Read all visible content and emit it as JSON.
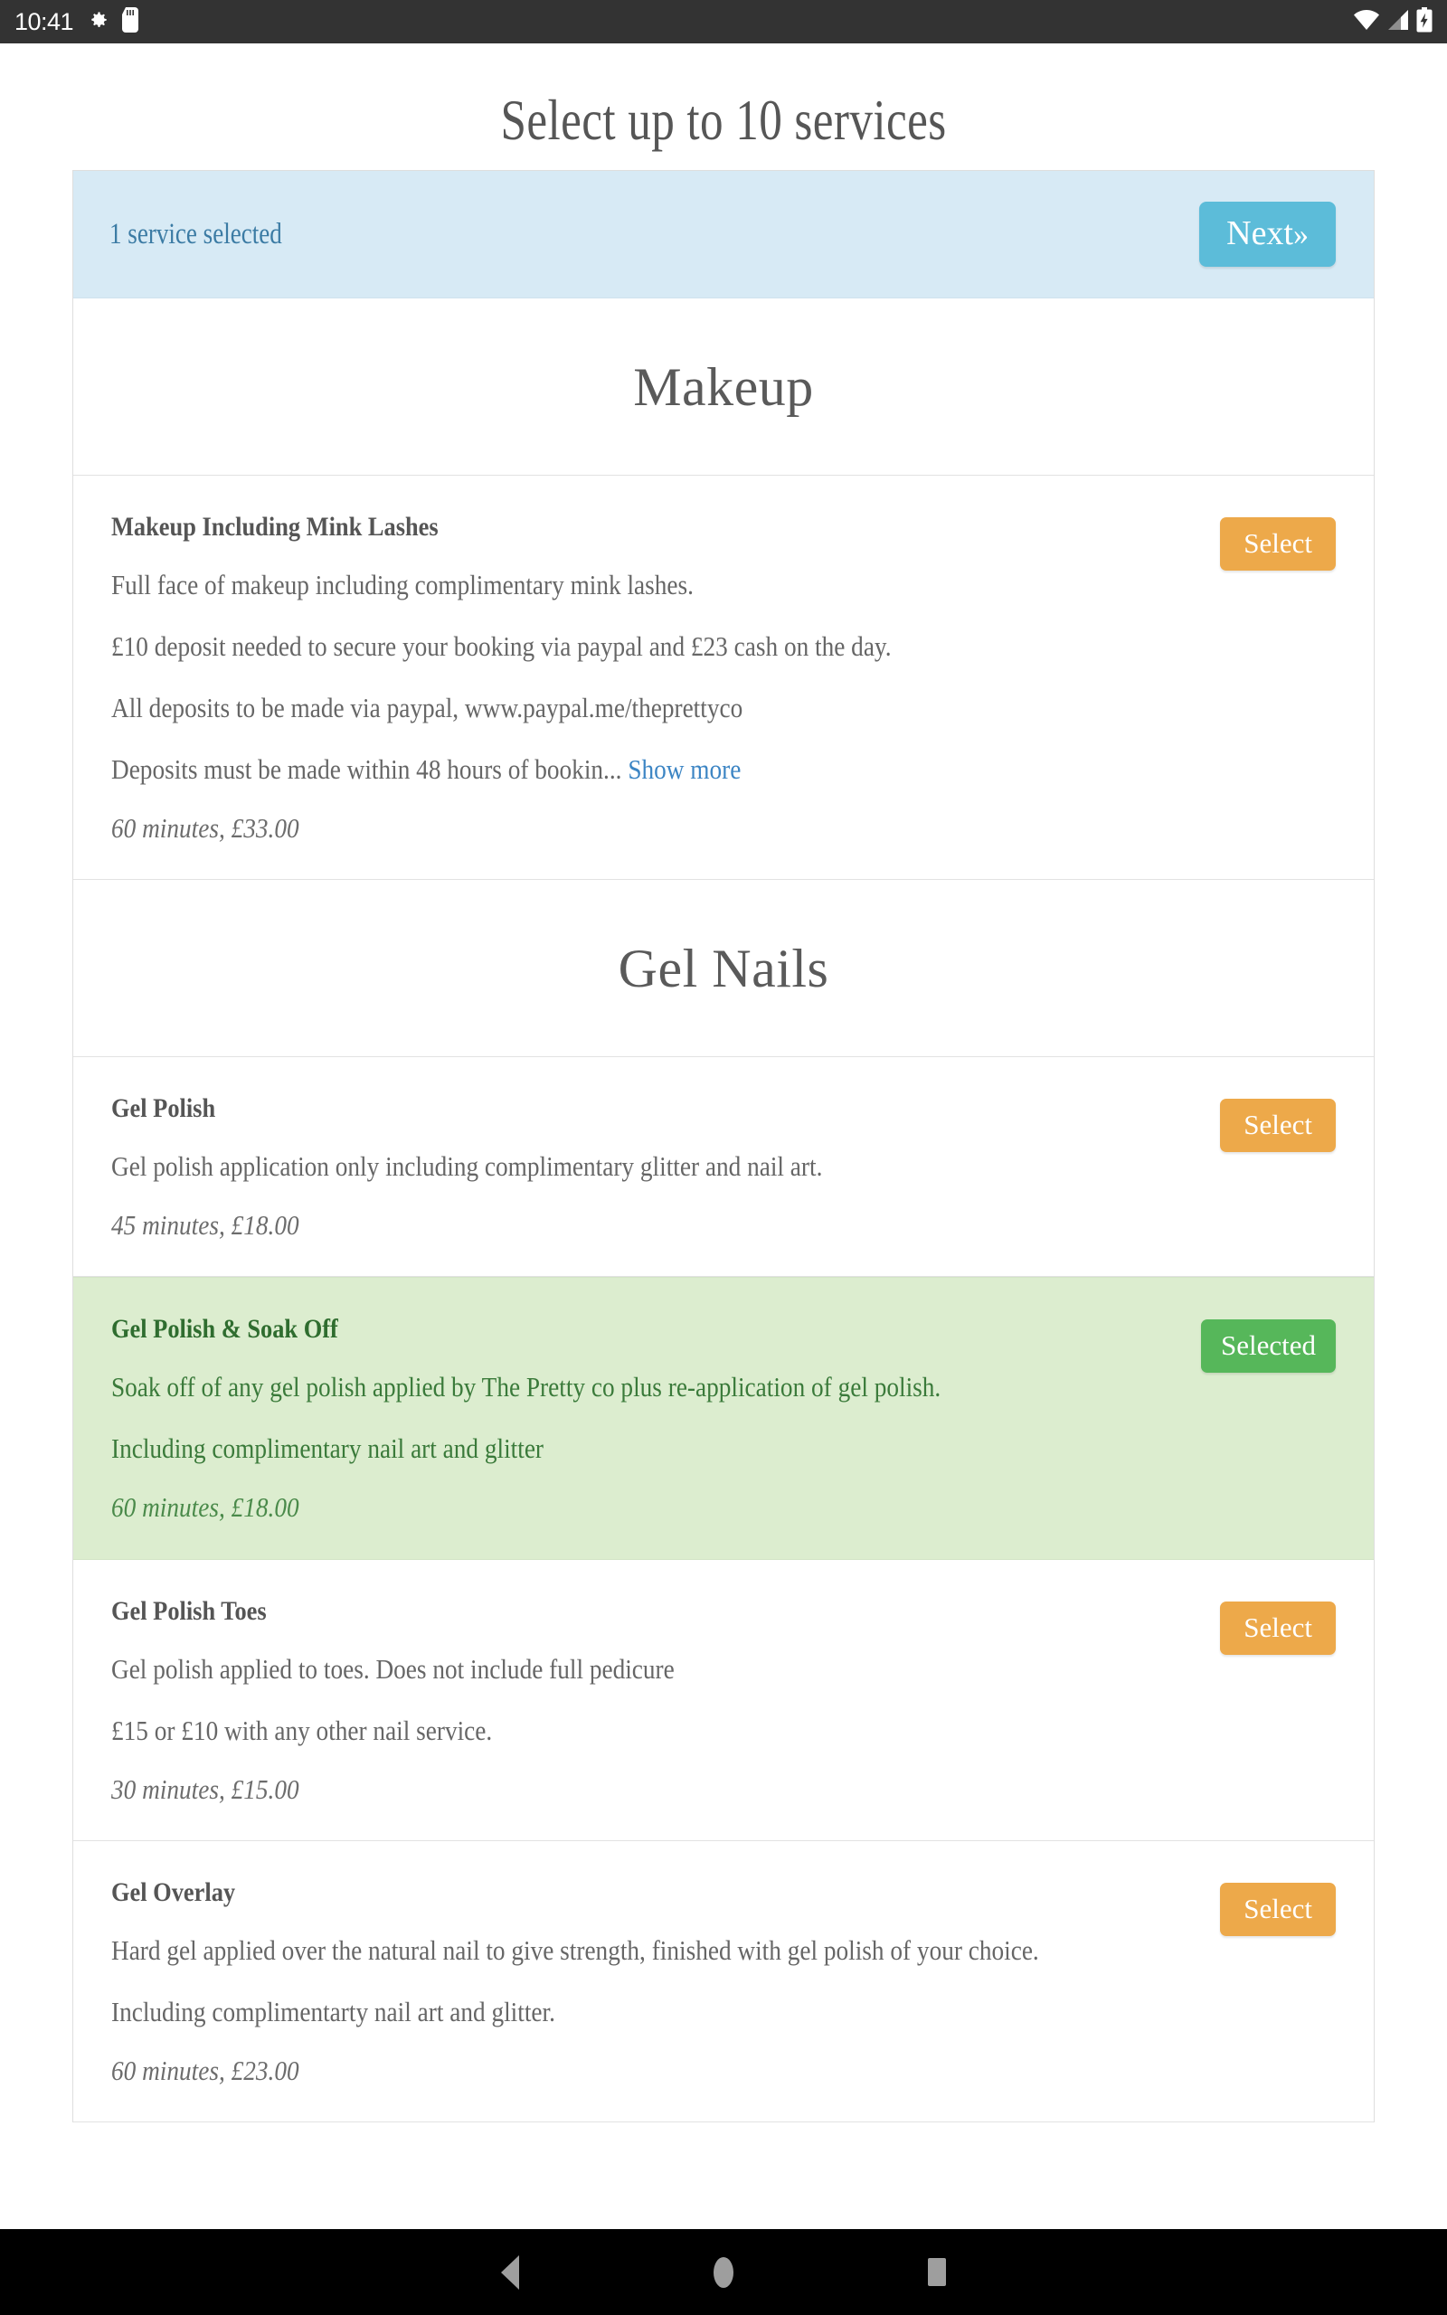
{
  "status_bar": {
    "clock": "10:41",
    "left_icons": [
      "gear-icon",
      "sd-card-icon"
    ],
    "right_icons": [
      "wifi-icon",
      "signal-icon",
      "battery-charging-icon"
    ],
    "background": "#333333"
  },
  "page": {
    "title": "Select up to 10 services"
  },
  "banner": {
    "status_text": "1 service selected",
    "next_label": "Next",
    "next_chevron": "»",
    "background": "#d7eaf5",
    "text_color": "#3b7ba4",
    "button_color": "#5cbcd9"
  },
  "colors": {
    "select_button": "#eda94a",
    "selected_button": "#56b75a",
    "selected_row_bg": "#dcedcf",
    "link": "#3c85c4"
  },
  "sections": [
    {
      "heading": "Makeup",
      "services": [
        {
          "name": "Makeup Including Mink Lashes",
          "paragraphs": [
            "Full face of makeup including complimentary mink lashes.",
            "£10 deposit needed to secure your booking via paypal and £23 cash on the day.",
            "All deposits to be made via paypal, www.paypal.me/theprettyco"
          ],
          "truncated_paragraph": "Deposits must be made within 48 hours of bookin...",
          "show_more_label": "Show more",
          "meta": "60 minutes, £33.00",
          "action_label": "Select",
          "selected": false
        }
      ]
    },
    {
      "heading": "Gel Nails",
      "services": [
        {
          "name": "Gel Polish",
          "paragraphs": [
            "Gel polish application only including complimentary glitter and nail art."
          ],
          "meta": "45 minutes, £18.00",
          "action_label": "Select",
          "selected": false
        },
        {
          "name": "Gel Polish & Soak Off",
          "paragraphs": [
            "Soak off of any gel polish applied by The Pretty co plus re-application of gel polish.",
            "Including complimentary nail art and glitter"
          ],
          "meta": "60 minutes, £18.00",
          "action_label": "Selected",
          "selected": true
        },
        {
          "name": "Gel Polish Toes",
          "paragraphs": [
            "Gel polish applied to toes. Does not include full pedicure",
            "£15 or £10 with any other nail service."
          ],
          "meta": "30 minutes, £15.00",
          "action_label": "Select",
          "selected": false
        },
        {
          "name": "Gel Overlay",
          "paragraphs": [
            "Hard gel applied over the natural nail to give strength, finished with gel polish of your choice.",
            "Including complimentarty nail art and glitter."
          ],
          "meta": "60 minutes, £23.00",
          "action_label": "Select",
          "selected": false
        }
      ]
    }
  ],
  "nav_bar": {
    "buttons": [
      "back-button",
      "home-button",
      "recents-button"
    ]
  }
}
